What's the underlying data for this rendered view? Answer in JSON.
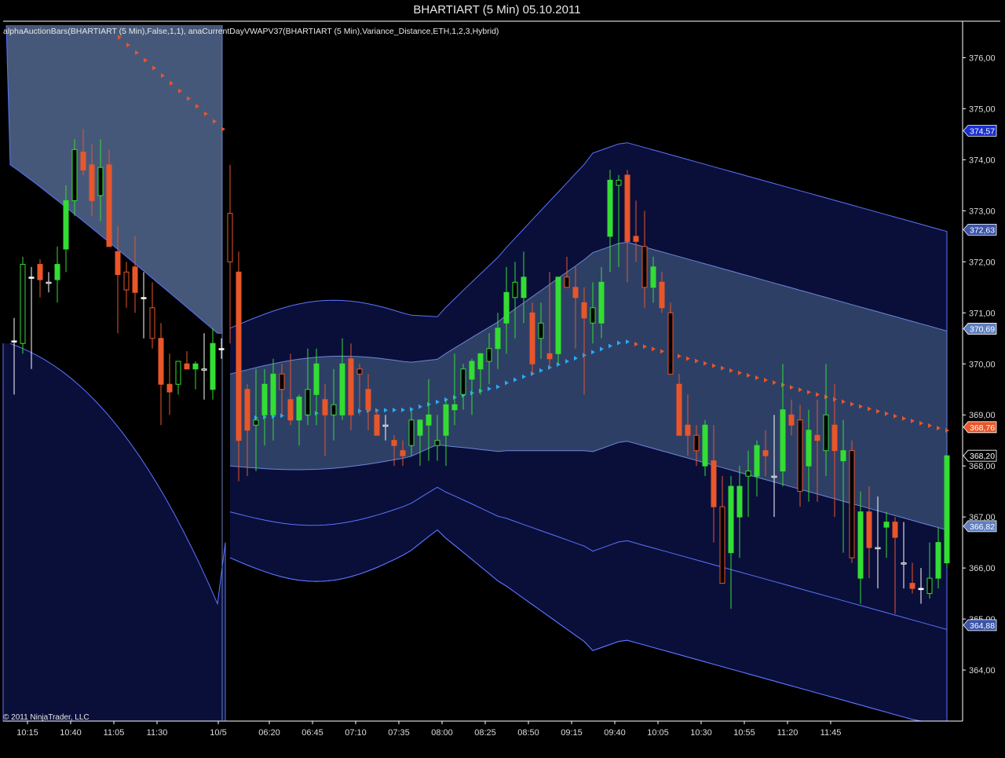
{
  "chart_data": {
    "type": "candlestick",
    "title": "BHARTIART (5 Min)  05.10.2011",
    "indicator_label": "alphaAuctionBars(BHARTIART (5 Min),False,1,1),  anaCurrentDayVWAPV37(BHARTIART (5 Min),Variance_Distance,ETH,1,2,3,Hybrid)",
    "copyright": "© 2011 NinjaTrader, LLC",
    "ylim": [
      363.0,
      376.7
    ],
    "y_ticks": [
      "364,00",
      "365,00",
      "366,00",
      "367,00",
      "368,00",
      "369,00",
      "370,00",
      "371,00",
      "372,00",
      "373,00",
      "374,00",
      "375,00",
      "376,00"
    ],
    "x_ticks": [
      "10:15",
      "10:40",
      "11:05",
      "11:30",
      "10/5",
      "06:20",
      "06:45",
      "07:10",
      "07:35",
      "08:00",
      "08:25",
      "08:50",
      "09:15",
      "09:40",
      "10:05",
      "10:30",
      "10:55",
      "11:20",
      "11:45"
    ],
    "price_badges": [
      {
        "label": "374,57",
        "value": 374.57,
        "color": "#1a2fd0"
      },
      {
        "label": "372,63",
        "value": 372.63,
        "color": "#3a55a8"
      },
      {
        "label": "370,69",
        "value": 370.69,
        "color": "#5f7fc0"
      },
      {
        "label": "368,76",
        "value": 368.76,
        "color": "#e8562a"
      },
      {
        "label": "368,20",
        "value": 368.2,
        "color": "#000000"
      },
      {
        "label": "366,82",
        "value": 366.82,
        "color": "#5f7fc0"
      },
      {
        "label": "364,88",
        "value": 364.88,
        "color": "#3a55a8"
      }
    ],
    "colors": {
      "background": "#000000",
      "up": "#33dd33",
      "down": "#e8562a",
      "doji": "#ffffff",
      "inner_band": "#2e3f66",
      "outer_band": "#0a0f3a",
      "band_edge": "#5a73ff",
      "prev_band": "#465879",
      "vwap_up": "#29aaf5",
      "vwap_down": "#e8562a"
    },
    "session_break_index": 25,
    "candles": [
      {
        "o": 370.45,
        "h": 370.9,
        "l": 369.4,
        "c": 370.45
      },
      {
        "o": 370.4,
        "h": 372.1,
        "l": 370.2,
        "c": 371.95
      },
      {
        "o": 371.7,
        "h": 371.9,
        "l": 369.9,
        "c": 371.7
      },
      {
        "o": 371.95,
        "h": 372.05,
        "l": 371.3,
        "c": 371.65
      },
      {
        "o": 371.6,
        "h": 371.8,
        "l": 371.4,
        "c": 371.6
      },
      {
        "o": 371.65,
        "h": 372.3,
        "l": 371.2,
        "c": 371.95
      },
      {
        "o": 372.25,
        "h": 373.5,
        "l": 371.8,
        "c": 373.2
      },
      {
        "o": 373.2,
        "h": 374.4,
        "l": 372.9,
        "c": 374.2
      },
      {
        "o": 374.15,
        "h": 374.6,
        "l": 373.7,
        "c": 373.8
      },
      {
        "o": 373.9,
        "h": 374.3,
        "l": 372.9,
        "c": 373.2
      },
      {
        "o": 373.3,
        "h": 374.4,
        "l": 372.8,
        "c": 373.85
      },
      {
        "o": 373.9,
        "h": 374.2,
        "l": 372.6,
        "c": 372.3
      },
      {
        "o": 372.2,
        "h": 372.7,
        "l": 370.6,
        "c": 371.75
      },
      {
        "o": 371.8,
        "h": 372.0,
        "l": 371.1,
        "c": 371.45
      },
      {
        "o": 371.9,
        "h": 372.5,
        "l": 371.0,
        "c": 371.4
      },
      {
        "o": 371.3,
        "h": 371.8,
        "l": 370.5,
        "c": 371.3
      },
      {
        "o": 371.1,
        "h": 371.6,
        "l": 370.3,
        "c": 370.5
      },
      {
        "o": 370.5,
        "h": 370.8,
        "l": 368.8,
        "c": 369.6
      },
      {
        "o": 369.6,
        "h": 370.2,
        "l": 369.0,
        "c": 369.45
      },
      {
        "o": 369.6,
        "h": 370.05,
        "l": 369.4,
        "c": 370.05
      },
      {
        "o": 370.0,
        "h": 370.25,
        "l": 369.9,
        "c": 369.9
      },
      {
        "o": 369.9,
        "h": 370.05,
        "l": 369.5,
        "c": 370.0
      },
      {
        "o": 369.9,
        "h": 370.6,
        "l": 369.3,
        "c": 369.9
      },
      {
        "o": 369.5,
        "h": 370.7,
        "l": 369.3,
        "c": 370.4
      },
      {
        "o": 370.3,
        "h": 370.5,
        "l": 370.1,
        "c": 370.3
      },
      {
        "o": 372.95,
        "h": 373.9,
        "l": 370.4,
        "c": 372.0
      },
      {
        "o": 371.8,
        "h": 372.2,
        "l": 367.7,
        "c": 368.5
      },
      {
        "o": 369.5,
        "h": 369.6,
        "l": 367.8,
        "c": 368.7
      },
      {
        "o": 368.8,
        "h": 369.9,
        "l": 367.9,
        "c": 368.9
      },
      {
        "o": 369.0,
        "h": 369.9,
        "l": 368.4,
        "c": 369.6
      },
      {
        "o": 369.0,
        "h": 370.1,
        "l": 368.5,
        "c": 369.8
      },
      {
        "o": 369.8,
        "h": 370.0,
        "l": 369.0,
        "c": 369.5
      },
      {
        "o": 369.3,
        "h": 370.2,
        "l": 368.8,
        "c": 368.9
      },
      {
        "o": 368.9,
        "h": 369.4,
        "l": 368.4,
        "c": 369.35
      },
      {
        "o": 369.0,
        "h": 370.3,
        "l": 368.8,
        "c": 369.5
      },
      {
        "o": 369.4,
        "h": 370.3,
        "l": 368.8,
        "c": 370.0
      },
      {
        "o": 369.3,
        "h": 369.6,
        "l": 368.2,
        "c": 369.0
      },
      {
        "o": 369.0,
        "h": 369.9,
        "l": 368.5,
        "c": 369.2
      },
      {
        "o": 369.0,
        "h": 370.5,
        "l": 368.9,
        "c": 370.0
      },
      {
        "o": 370.1,
        "h": 370.4,
        "l": 368.7,
        "c": 369.0
      },
      {
        "o": 369.9,
        "h": 370.0,
        "l": 369.0,
        "c": 369.8
      },
      {
        "o": 369.5,
        "h": 369.8,
        "l": 368.7,
        "c": 369.1
      },
      {
        "o": 369.0,
        "h": 369.1,
        "l": 368.6,
        "c": 368.6
      },
      {
        "o": 368.8,
        "h": 369.0,
        "l": 368.5,
        "c": 368.8
      },
      {
        "o": 368.5,
        "h": 368.6,
        "l": 368.0,
        "c": 368.4
      },
      {
        "o": 368.3,
        "h": 368.5,
        "l": 368.0,
        "c": 368.2
      },
      {
        "o": 368.4,
        "h": 369.1,
        "l": 368.2,
        "c": 368.9
      },
      {
        "o": 368.6,
        "h": 368.9,
        "l": 368.0,
        "c": 368.9
      },
      {
        "o": 368.8,
        "h": 369.7,
        "l": 368.1,
        "c": 369.0
      },
      {
        "o": 368.4,
        "h": 369.0,
        "l": 368.1,
        "c": 368.5
      },
      {
        "o": 368.6,
        "h": 369.3,
        "l": 368.0,
        "c": 369.2
      },
      {
        "o": 369.1,
        "h": 370.2,
        "l": 368.8,
        "c": 369.2
      },
      {
        "o": 369.4,
        "h": 370.0,
        "l": 369.1,
        "c": 369.9
      },
      {
        "o": 369.7,
        "h": 370.1,
        "l": 369.0,
        "c": 370.05
      },
      {
        "o": 369.9,
        "h": 370.2,
        "l": 369.4,
        "c": 370.2
      },
      {
        "o": 370.05,
        "h": 370.6,
        "l": 369.6,
        "c": 370.3
      },
      {
        "o": 370.3,
        "h": 371.0,
        "l": 369.9,
        "c": 370.7
      },
      {
        "o": 370.8,
        "h": 371.9,
        "l": 370.2,
        "c": 371.4
      },
      {
        "o": 371.3,
        "h": 372.0,
        "l": 370.5,
        "c": 371.6
      },
      {
        "o": 371.3,
        "h": 372.2,
        "l": 370.8,
        "c": 371.7
      },
      {
        "o": 371.0,
        "h": 371.2,
        "l": 369.8,
        "c": 370.0
      },
      {
        "o": 370.5,
        "h": 371.2,
        "l": 370.1,
        "c": 370.8
      },
      {
        "o": 370.2,
        "h": 371.8,
        "l": 369.9,
        "c": 370.1
      },
      {
        "o": 370.2,
        "h": 371.6,
        "l": 370.0,
        "c": 371.7
      },
      {
        "o": 371.7,
        "h": 372.1,
        "l": 371.5,
        "c": 371.5
      },
      {
        "o": 371.5,
        "h": 371.9,
        "l": 370.3,
        "c": 371.3
      },
      {
        "o": 371.2,
        "h": 371.5,
        "l": 369.4,
        "c": 370.9
      },
      {
        "o": 370.8,
        "h": 371.6,
        "l": 370.4,
        "c": 371.1
      },
      {
        "o": 370.8,
        "h": 371.9,
        "l": 370.5,
        "c": 371.6
      },
      {
        "o": 372.5,
        "h": 373.8,
        "l": 371.8,
        "c": 373.6
      },
      {
        "o": 373.5,
        "h": 373.7,
        "l": 371.9,
        "c": 373.6
      },
      {
        "o": 373.7,
        "h": 373.8,
        "l": 371.6,
        "c": 372.4
      },
      {
        "o": 372.5,
        "h": 373.2,
        "l": 372.0,
        "c": 372.4
      },
      {
        "o": 372.3,
        "h": 373.0,
        "l": 371.1,
        "c": 371.5
      },
      {
        "o": 371.5,
        "h": 372.1,
        "l": 371.2,
        "c": 371.9
      },
      {
        "o": 371.6,
        "h": 371.8,
        "l": 371.0,
        "c": 371.1
      },
      {
        "o": 371.0,
        "h": 371.2,
        "l": 369.8,
        "c": 369.8
      },
      {
        "o": 369.6,
        "h": 369.8,
        "l": 368.6,
        "c": 368.6
      },
      {
        "o": 368.8,
        "h": 369.4,
        "l": 368.2,
        "c": 368.6
      },
      {
        "o": 368.6,
        "h": 368.8,
        "l": 368.0,
        "c": 368.3
      },
      {
        "o": 368.0,
        "h": 368.9,
        "l": 367.8,
        "c": 368.8
      },
      {
        "o": 368.1,
        "h": 368.8,
        "l": 366.5,
        "c": 367.2
      },
      {
        "o": 367.2,
        "h": 367.8,
        "l": 365.7,
        "c": 365.7
      },
      {
        "o": 366.3,
        "h": 367.8,
        "l": 365.2,
        "c": 367.6
      },
      {
        "o": 367.0,
        "h": 368.0,
        "l": 366.2,
        "c": 367.6
      },
      {
        "o": 367.8,
        "h": 368.3,
        "l": 367.0,
        "c": 367.9
      },
      {
        "o": 367.8,
        "h": 368.5,
        "l": 367.4,
        "c": 368.4
      },
      {
        "o": 368.3,
        "h": 368.7,
        "l": 367.8,
        "c": 368.2
      },
      {
        "o": 367.8,
        "h": 369.0,
        "l": 367.0,
        "c": 367.8
      },
      {
        "o": 367.9,
        "h": 370.0,
        "l": 367.6,
        "c": 369.1
      },
      {
        "o": 369.0,
        "h": 369.3,
        "l": 368.6,
        "c": 368.8
      },
      {
        "o": 368.9,
        "h": 369.2,
        "l": 367.2,
        "c": 367.5
      },
      {
        "o": 368.0,
        "h": 369.1,
        "l": 367.3,
        "c": 368.7
      },
      {
        "o": 368.6,
        "h": 369.3,
        "l": 367.3,
        "c": 368.5
      },
      {
        "o": 368.3,
        "h": 370.0,
        "l": 367.8,
        "c": 369.0
      },
      {
        "o": 368.8,
        "h": 369.6,
        "l": 367.0,
        "c": 368.3
      },
      {
        "o": 368.1,
        "h": 368.9,
        "l": 366.3,
        "c": 368.3
      },
      {
        "o": 368.3,
        "h": 368.5,
        "l": 366.1,
        "c": 366.2
      },
      {
        "o": 365.8,
        "h": 367.5,
        "l": 365.3,
        "c": 367.1
      },
      {
        "o": 367.1,
        "h": 367.6,
        "l": 365.8,
        "c": 366.4
      },
      {
        "o": 366.4,
        "h": 367.4,
        "l": 365.6,
        "c": 366.4
      },
      {
        "o": 366.8,
        "h": 367.1,
        "l": 366.2,
        "c": 366.9
      },
      {
        "o": 366.9,
        "h": 367.0,
        "l": 365.1,
        "c": 366.6
      },
      {
        "o": 366.1,
        "h": 366.9,
        "l": 365.6,
        "c": 366.1
      },
      {
        "o": 365.7,
        "h": 366.1,
        "l": 365.5,
        "c": 365.6
      },
      {
        "o": 365.6,
        "h": 366.0,
        "l": 365.3,
        "c": 365.6
      },
      {
        "o": 365.5,
        "h": 366.5,
        "l": 365.4,
        "c": 365.8
      },
      {
        "o": 365.8,
        "h": 366.8,
        "l": 365.6,
        "c": 366.5
      },
      {
        "o": 366.1,
        "h": 367.4,
        "l": 366.0,
        "c": 368.2
      }
    ]
  }
}
